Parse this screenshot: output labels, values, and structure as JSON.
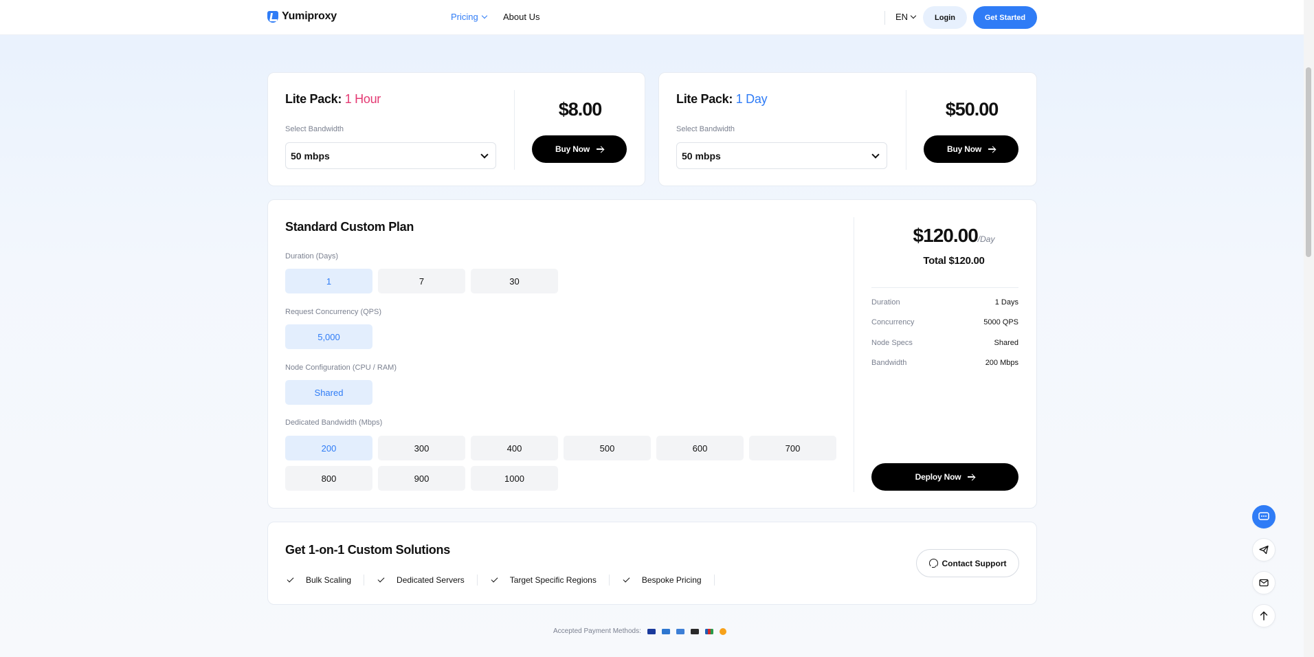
{
  "nav": {
    "brand": "Yumiproxy",
    "links": [
      {
        "label": "Pricing",
        "active": true,
        "has_dropdown": true
      },
      {
        "label": "About Us",
        "active": false,
        "has_dropdown": false
      }
    ],
    "language": "EN",
    "login_label": "Login",
    "get_started_label": "Get Started"
  },
  "lite_packs": [
    {
      "title_prefix": "Lite Pack:",
      "duration": "1 Hour",
      "accent": "#e43a73",
      "bandwidth_label": "Select Bandwidth",
      "bandwidth_value": "50 mbps",
      "price": "$8.00",
      "buy_label": "Buy Now"
    },
    {
      "title_prefix": "Lite Pack:",
      "duration": "1 Day",
      "accent": "#2f7cf6",
      "bandwidth_label": "Select Bandwidth",
      "bandwidth_value": "50 mbps",
      "price": "$50.00",
      "buy_label": "Buy Now"
    }
  ],
  "standard_plan": {
    "title": "Standard Custom Plan",
    "duration": {
      "label": "Duration (Days)",
      "options": [
        "1",
        "7",
        "30"
      ],
      "selected": "1"
    },
    "concurrency": {
      "label": "Request Concurrency (QPS)",
      "options": [
        "5,000"
      ],
      "selected": "5,000"
    },
    "node_config": {
      "label": "Node Configuration (CPU / RAM)",
      "options": [
        "Shared"
      ],
      "selected": "Shared"
    },
    "bandwidth": {
      "label": "Dedicated Bandwidth (Mbps)",
      "options": [
        "200",
        "300",
        "400",
        "500",
        "600",
        "700",
        "800",
        "900",
        "1000"
      ],
      "selected": "200"
    },
    "summary": {
      "price": "$120.00",
      "per": "/Day",
      "total": "Total $120.00",
      "rows": [
        {
          "key": "Duration",
          "value": "1 Days"
        },
        {
          "key": "Concurrency",
          "value": "5000 QPS"
        },
        {
          "key": "Node Specs",
          "value": "Shared"
        },
        {
          "key": "Bandwidth",
          "value": "200 Mbps"
        }
      ],
      "deploy_label": "Deploy Now"
    }
  },
  "custom_solutions": {
    "title": "Get 1-on-1 Custom Solutions",
    "features": [
      "Bulk Scaling",
      "Dedicated Servers",
      "Target Specific Regions",
      "Bespoke Pricing"
    ],
    "contact_label": "Contact Support"
  },
  "payments": {
    "label": "Accepted Payment Methods:",
    "icons": [
      {
        "name": "visa-icon",
        "color": "#1a3a9c"
      },
      {
        "name": "amex-icon",
        "color": "#2e77d0"
      },
      {
        "name": "diners-icon",
        "color": "#3d7fd6"
      },
      {
        "name": "mastercard-icon",
        "color": "#2a2a2a"
      },
      {
        "name": "jcb-icon",
        "color": "#1f5fb4"
      },
      {
        "name": "bitcoin-icon",
        "color": "#f7a21b"
      }
    ]
  },
  "floating": [
    "chat-icon",
    "send-icon",
    "mail-icon",
    "arrow-up-icon"
  ],
  "colors": {
    "accent_blue": "#2f7cf6",
    "accent_pink": "#e43a73",
    "selected_bg": "#e3eefd"
  }
}
